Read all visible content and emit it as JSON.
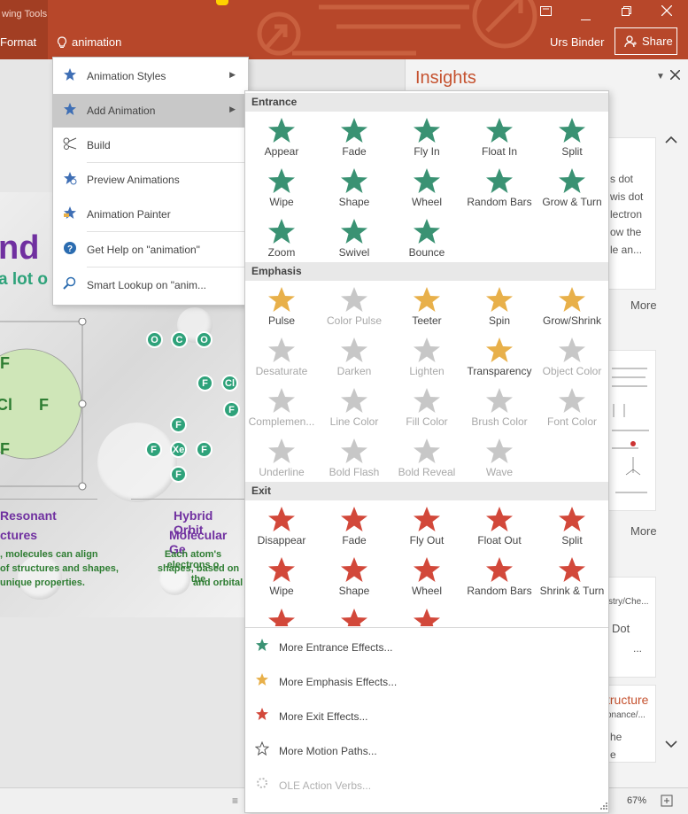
{
  "ribbon": {
    "context_title": "wing Tools",
    "format_tab": "Format",
    "tell_me_value": "animation",
    "user_name": "Urs Binder",
    "share_label": "Share",
    "window_buttons": [
      "restore-ribbon-icon",
      "minimize-icon",
      "restore-icon",
      "close-icon"
    ]
  },
  "menu": {
    "items": [
      {
        "label": "Animation Styles",
        "icon": "star-icon",
        "submenu": true
      },
      {
        "label": "Add Animation",
        "icon": "add-star-icon",
        "submenu": true,
        "selected": true
      },
      {
        "label": "Build",
        "icon": "build-icon",
        "submenu": false
      },
      {
        "label": "Preview Animations",
        "icon": "preview-star-icon",
        "submenu": false
      },
      {
        "label": "Animation Painter",
        "icon": "painter-icon",
        "submenu": false
      },
      {
        "label": "Get Help on \"animation\"",
        "icon": "help-icon",
        "submenu": false
      },
      {
        "label": "Smart Lookup on \"anim...",
        "icon": "smart-lookup-icon",
        "submenu": false
      }
    ]
  },
  "gallery": {
    "entrance_title": "Entrance",
    "entrance": [
      "Appear",
      "Fade",
      "Fly In",
      "Float In",
      "Split",
      "Wipe",
      "Shape",
      "Wheel",
      "Random Bars",
      "Grow & Turn",
      "Zoom",
      "Swivel",
      "Bounce"
    ],
    "emphasis_title": "Emphasis",
    "emphasis": [
      "Pulse",
      "Color Pulse",
      "Teeter",
      "Spin",
      "Grow/Shrink",
      "Desaturate",
      "Darken",
      "Lighten",
      "Transparency",
      "Object Color",
      "Complemen...",
      "Line Color",
      "Fill Color",
      "Brush Color",
      "Font Color",
      "Underline",
      "Bold Flash",
      "Bold Reveal",
      "Wave"
    ],
    "emphasis_enabled": [
      true,
      false,
      true,
      true,
      true,
      false,
      false,
      false,
      true,
      false,
      false,
      false,
      false,
      false,
      false,
      false,
      false,
      false,
      false
    ],
    "exit_title": "Exit",
    "exit": [
      "Disappear",
      "Fade",
      "Fly Out",
      "Float Out",
      "Split",
      "Wipe",
      "Shape",
      "Wheel",
      "Random Bars",
      "Shrink & Turn"
    ],
    "more": [
      {
        "label": "More Entrance Effects...",
        "icon": "green-star-icon"
      },
      {
        "label": "More Emphasis Effects...",
        "icon": "gold-star-icon"
      },
      {
        "label": "More Exit Effects...",
        "icon": "red-star-icon"
      },
      {
        "label": "More Motion Paths...",
        "icon": "outline-star-icon"
      },
      {
        "label": "OLE Action Verbs...",
        "icon": "ole-icon",
        "disabled": true
      }
    ],
    "colors": {
      "entrance": "#3a9273",
      "emphasis": "#e8b04a",
      "exit": "#d2483a",
      "disabled": "#b9b9b9"
    }
  },
  "slide": {
    "headline_fragment": "nd",
    "subline_fragment": "a lot o",
    "atoms_left": [
      "F",
      "Cl",
      "F",
      "F"
    ],
    "oco": [
      "O",
      "C",
      "O"
    ],
    "fcl": [
      "F",
      "Cl",
      "F"
    ],
    "xef": [
      "F",
      "F",
      "Xe",
      "F",
      "F"
    ],
    "left_heading_1": "Resonant",
    "left_heading_2": "ctures",
    "left_text_1": ", molecules can align",
    "left_text_2": "of structures and shapes,",
    "left_text_3": "unique properties.",
    "right_heading_1": "Hybrid Orbit",
    "right_heading_2": "Molecular Ge",
    "right_text_1": "Each atom's electrons o",
    "right_text_2": "shapes, based on the",
    "right_text_3": "and orbital"
  },
  "insights": {
    "title": "Insights",
    "card1_lines": [
      "s dot",
      "wis dot",
      "lectron",
      "ow the",
      "le an..."
    ],
    "card1_more": "More",
    "card2_more": "More",
    "card3_lines": [
      "stry/Che...",
      "Dot",
      "..."
    ],
    "card4_title": "tructure",
    "card4_lines": [
      "onance/...",
      "he",
      "e"
    ]
  },
  "status": {
    "zoom": "67%"
  }
}
